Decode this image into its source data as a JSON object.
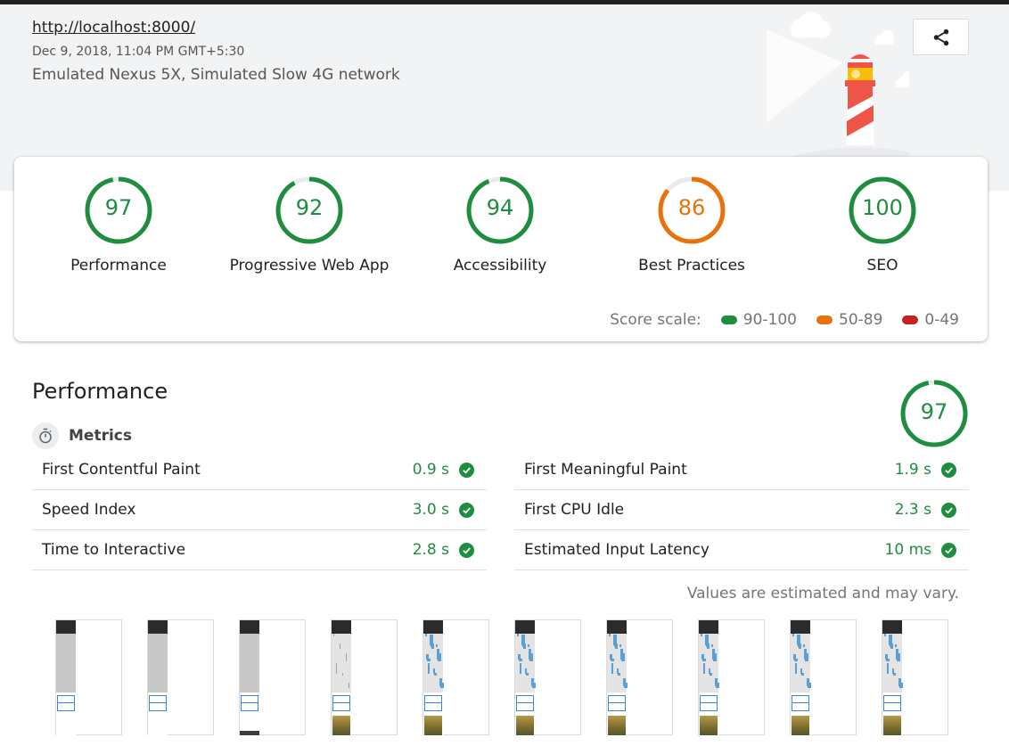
{
  "header": {
    "url": "http://localhost:8000/",
    "timestamp": "Dec 9, 2018, 11:04 PM GMT+5:30",
    "environment": "Emulated Nexus 5X, Simulated Slow 4G network",
    "share_icon": "share-icon"
  },
  "colors": {
    "pass": "#1e8e3e",
    "average": "#e8710a",
    "fail": "#c5221f",
    "track": "#e8eaed"
  },
  "scores": [
    {
      "label": "Performance",
      "value": "97",
      "score": 97,
      "status": "pass"
    },
    {
      "label": "Progressive Web App",
      "value": "92",
      "score": 92,
      "status": "pass"
    },
    {
      "label": "Accessibility",
      "value": "94",
      "score": 94,
      "status": "pass"
    },
    {
      "label": "Best Practices",
      "value": "86",
      "score": 86,
      "status": "average"
    },
    {
      "label": "SEO",
      "value": "100",
      "score": 100,
      "status": "pass"
    }
  ],
  "score_scale": {
    "label": "Score scale:",
    "ranges": [
      {
        "label": "90-100",
        "status": "pass"
      },
      {
        "label": "50-89",
        "status": "average"
      },
      {
        "label": "0-49",
        "status": "fail"
      }
    ]
  },
  "performance": {
    "title": "Performance",
    "score": "97",
    "score_value": 97,
    "metrics_label": "Metrics",
    "metrics_icon": "stopwatch-icon",
    "metrics_left": [
      {
        "label": "First Contentful Paint",
        "value": "0.9 s"
      },
      {
        "label": "Speed Index",
        "value": "3.0 s"
      },
      {
        "label": "Time to Interactive",
        "value": "2.8 s"
      }
    ],
    "metrics_right": [
      {
        "label": "First Meaningful Paint",
        "value": "1.9 s"
      },
      {
        "label": "First CPU Idle",
        "value": "2.3 s"
      },
      {
        "label": "Estimated Input Latency",
        "value": "10 ms"
      }
    ],
    "note": "Values are estimated and may vary."
  },
  "filmstrip": {
    "frames": [
      {
        "state": "blank"
      },
      {
        "state": "blank"
      },
      {
        "state": "blank-footer"
      },
      {
        "state": "map-light"
      },
      {
        "state": "map"
      },
      {
        "state": "map"
      },
      {
        "state": "map"
      },
      {
        "state": "map"
      },
      {
        "state": "map"
      },
      {
        "state": "map"
      }
    ]
  }
}
